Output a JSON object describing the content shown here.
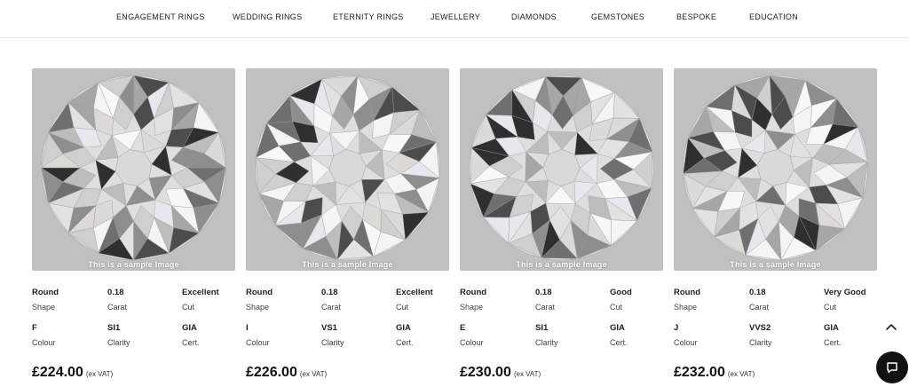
{
  "nav": {
    "items": [
      "ENGAGEMENT RINGS",
      "WEDDING RINGS",
      "ETERNITY RINGS",
      "JEWELLERY",
      "DIAMONDS",
      "GEMSTONES",
      "BESPOKE",
      "EDUCATION"
    ]
  },
  "sample_label": "This is a sample Image",
  "spec_labels": {
    "shape": "Shape",
    "carat": "Carat",
    "cut": "Cut",
    "colour": "Colour",
    "clarity": "Clarity",
    "cert": "Cert."
  },
  "vat_label": "(ex VAT)",
  "diamonds": [
    {
      "shape": "Round",
      "carat": "0.18",
      "cut": "Excellent",
      "colour": "F",
      "clarity": "SI1",
      "cert": "GIA",
      "price": "£224.00"
    },
    {
      "shape": "Round",
      "carat": "0.18",
      "cut": "Excellent",
      "colour": "I",
      "clarity": "VS1",
      "cert": "GIA",
      "price": "£226.00"
    },
    {
      "shape": "Round",
      "carat": "0.18",
      "cut": "Good",
      "colour": "E",
      "clarity": "SI1",
      "cert": "GIA",
      "price": "£230.00"
    },
    {
      "shape": "Round",
      "carat": "0.18",
      "cut": "Very Good",
      "colour": "J",
      "clarity": "VVS2",
      "cert": "GIA",
      "price": "£232.00"
    }
  ],
  "icons": {
    "scroll_top": "chevron-up-icon",
    "chat": "chat-icon"
  },
  "colors": {
    "image_background": "#c0c0c0",
    "chat_button": "#111111",
    "nav_border": "#e6e6e6"
  }
}
